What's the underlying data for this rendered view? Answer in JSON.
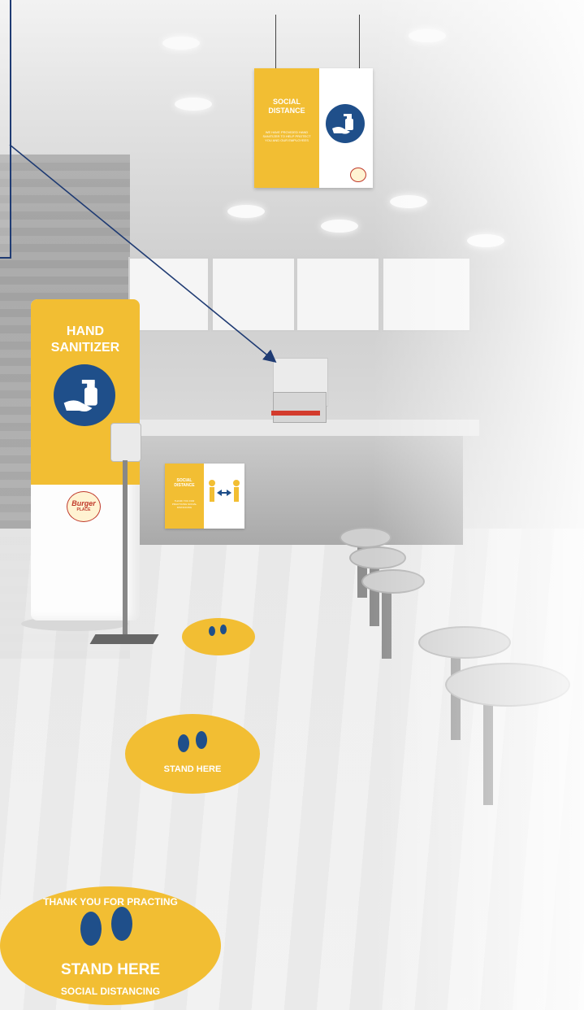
{
  "hanging_sign": {
    "title_line1": "SOCIAL",
    "title_line2": "DISTANCE",
    "body": "WE HAVE PROVIDED HAND SANITIZER TO HELP PROTECT YOU AND OUR EMPLOYEES",
    "icon": "hand-sanitizer-icon"
  },
  "tower": {
    "title_line1": "HAND",
    "title_line2": "SANITIZER",
    "icon": "hand-sanitizer-icon",
    "logo_line1": "Burger",
    "logo_line2": "PLACE"
  },
  "wall_sign": {
    "title_line1": "SOCIAL",
    "title_line2": "DISTANCE",
    "body": "THANK YOU FOR PRACTICING SOCIAL DISTANCING",
    "icon": "two-people-arrows-icon"
  },
  "floor_sticker": {
    "top_text": "THANK YOU FOR PRACTING",
    "middle_text": "STAND HERE",
    "bottom_text": "SOCIAL DISTANCING",
    "icon": "footprints-icon"
  },
  "colors": {
    "accent_yellow": "#f2be33",
    "brand_blue": "#1f4f8a",
    "callout_line": "#1f3b73"
  }
}
